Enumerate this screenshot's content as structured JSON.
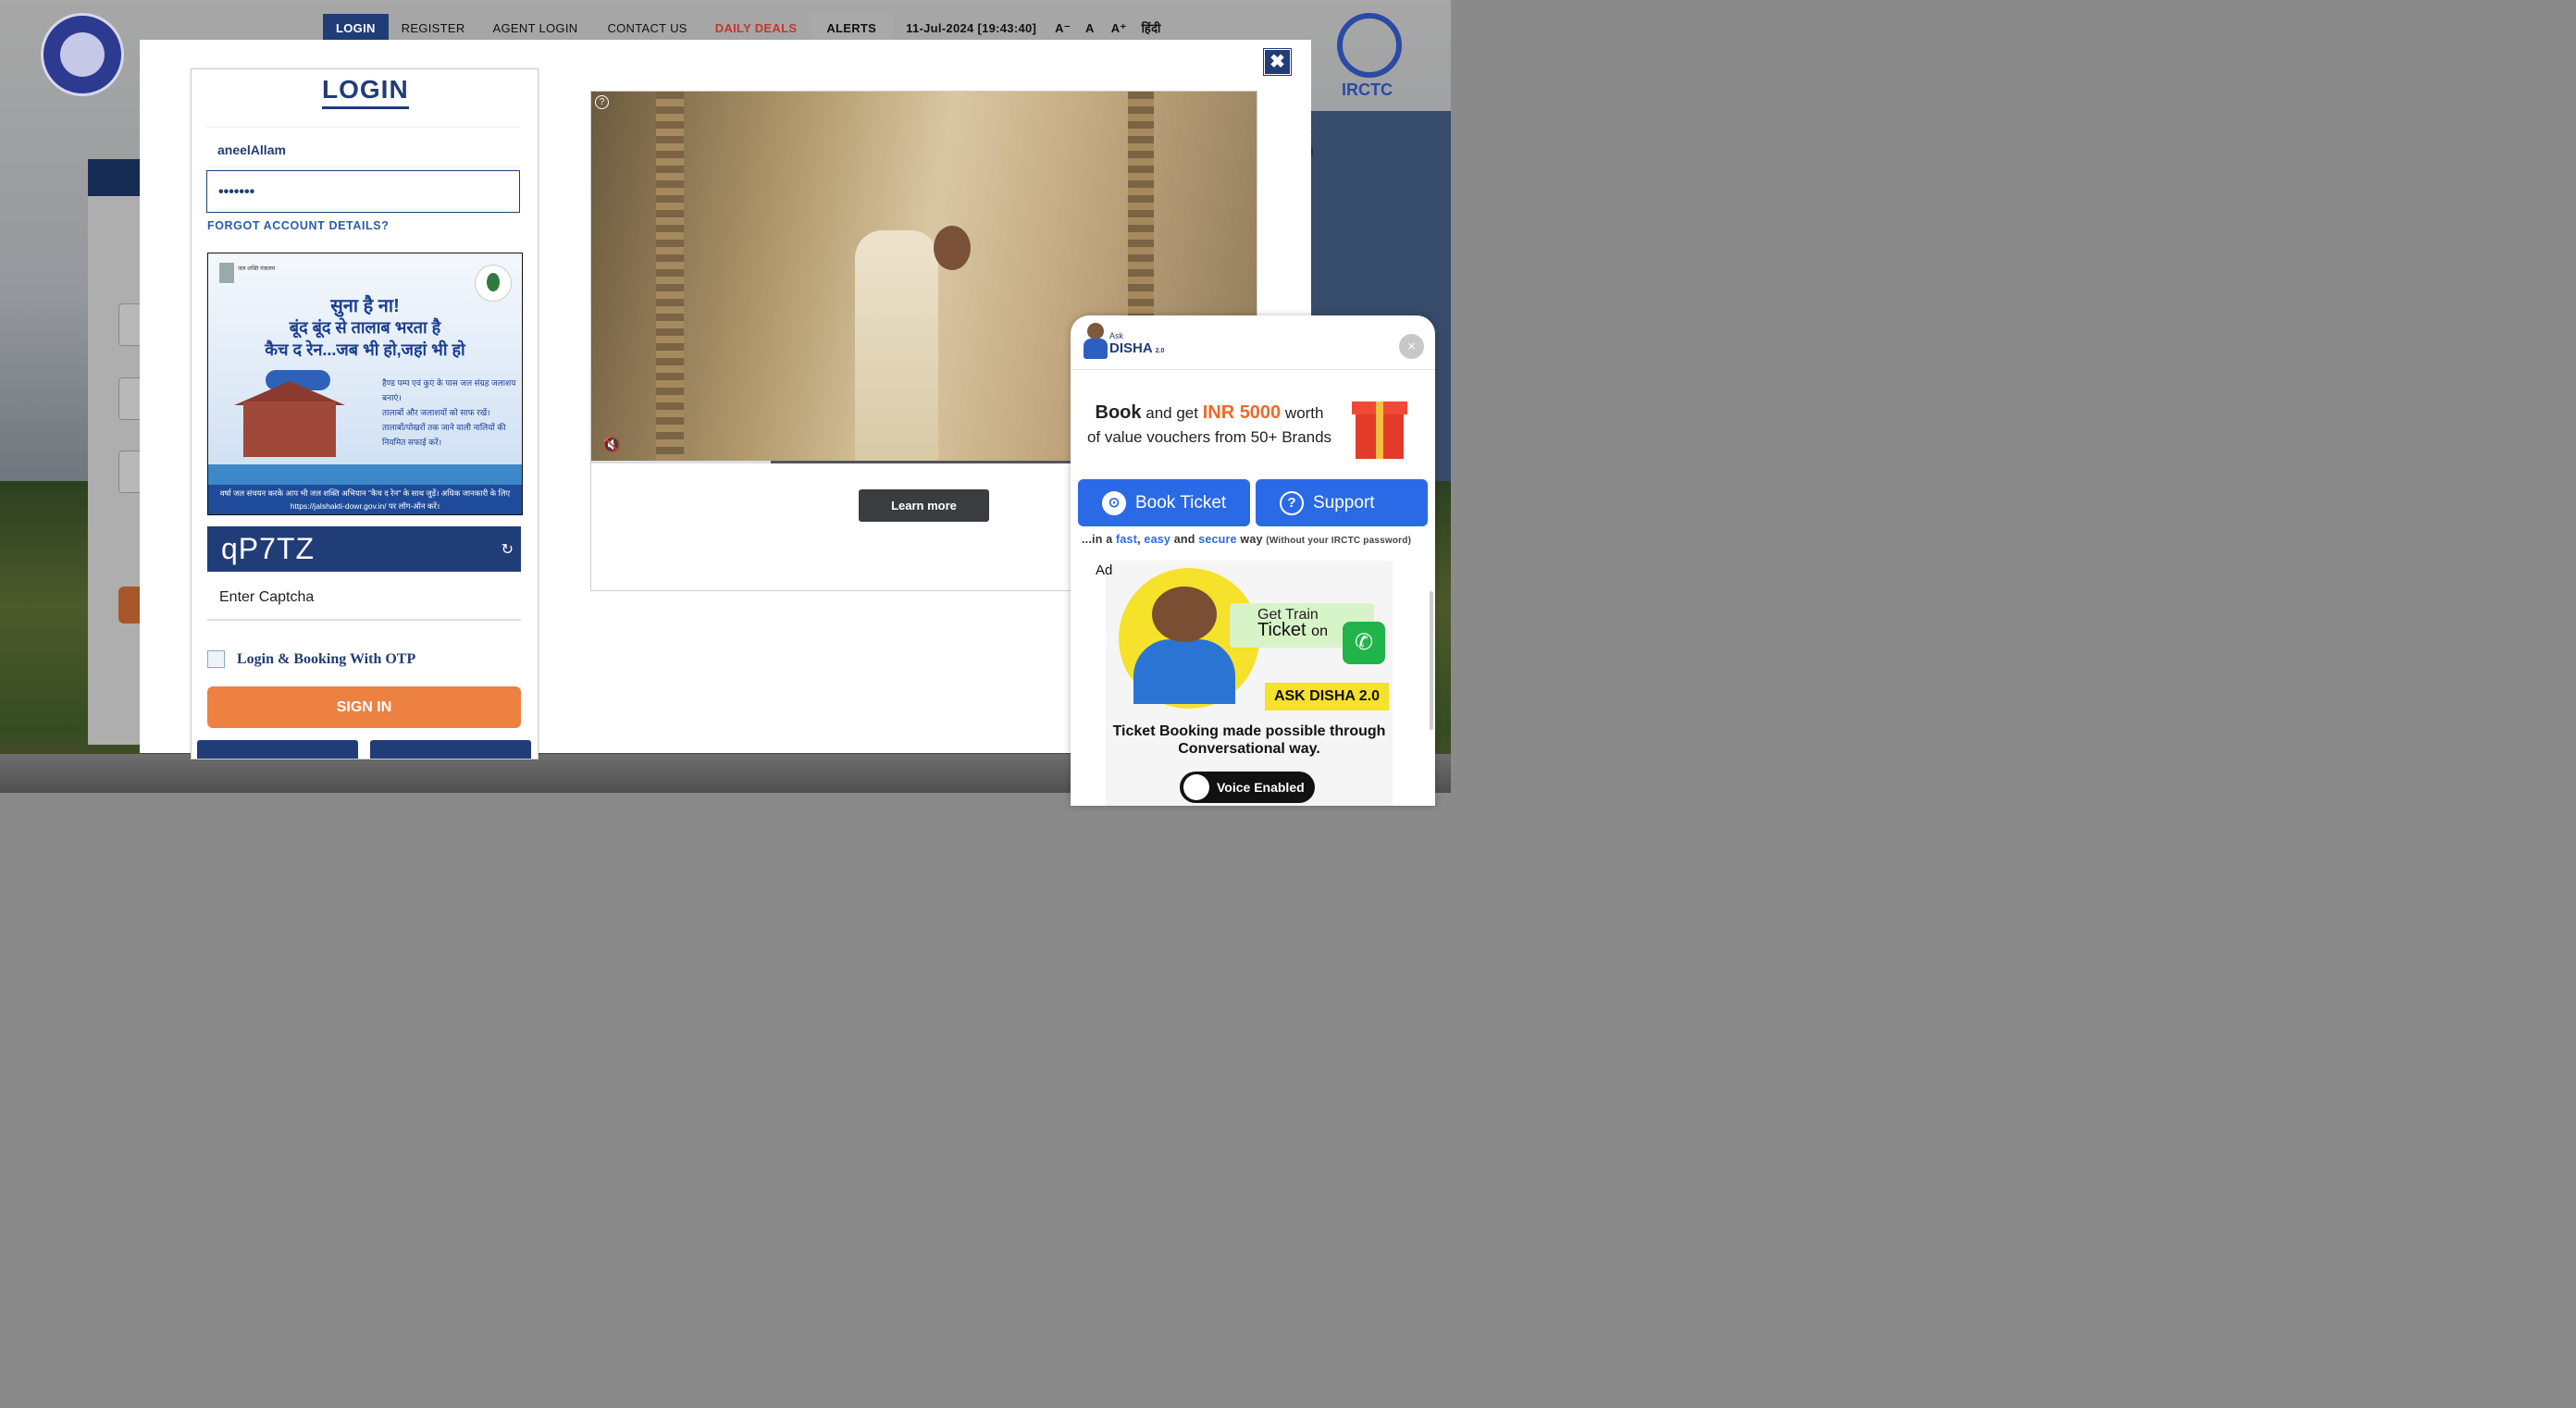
{
  "nav": {
    "items": [
      "LOGIN",
      "REGISTER",
      "AGENT LOGIN",
      "CONTACT US",
      "DAILY DEALS",
      "ALERTS"
    ],
    "datetime": "11-Jul-2024 [19:43:40]",
    "font_small": "A⁻",
    "font_normal": "A",
    "font_large": "A⁺",
    "hindi": "हिंदी"
  },
  "logos": {
    "irctc": "IRCTC"
  },
  "modal": {
    "close_icon": "✖",
    "login": {
      "title": "LOGIN",
      "username": "aneelAllam",
      "password_mask": "•••••••",
      "forgot": "FORGOT ACCOUNT DETAILS?",
      "captcha_code": "qP7TZ",
      "captcha_refresh_icon": "↻",
      "captcha_placeholder": "Enter Captcha",
      "otp_label": "Login & Booking With OTP",
      "signin": "SIGN IN"
    },
    "jal_ad": {
      "ministry": "जल शक्ति मंत्रालय",
      "line1": "सुना है ना!",
      "line2": "बूंद बूंद से तालाब भरता है",
      "line3": "कैच द रेन...जब भी हो,जहां भी हो",
      "bullets": [
        "हैण्ड पम्प एवं कुएं के पास जल संग्रह जलाशय बनाएं।",
        "तालाबों और जलाशयों को साफ रखें।",
        "तालाबों/पोखरों तक जाने वाली नालियों की नियमित सफाई करें।"
      ],
      "footer": "वर्षा जल संचयन करके आप भी जल शक्ति अभियान \"कैच द रेन\" के साथ जुड़ें। अधिक जानकारी के लिए https://jalshakti-dowr.gov.in/ पर लॉग-ऑन करें।"
    },
    "video_ad": {
      "help_icon": "?",
      "mute_icon": "🔇",
      "progress": 0.27,
      "learn_more": "Learn more"
    }
  },
  "disha": {
    "ask": "Ask",
    "name": "DISHA",
    "version": "2.0",
    "close_icon": "×",
    "promo_book": "Book",
    "promo_and": " and get ",
    "promo_inr": "INR 5000",
    "promo_worth": " worth",
    "promo_line2": "of value vouchers from 50+ Brands",
    "book_ticket": "Book Ticket",
    "support": "Support",
    "tag_pre": "...in a ",
    "tag_fast": "fast",
    "tag_easy": "easy",
    "tag_and": " and ",
    "tag_secure": "secure",
    "tag_way": " way ",
    "tag_small": "(Without your IRCTC password)",
    "ad_label": "Ad",
    "ad_get": "Get Train",
    "ad_ticket": "Ticket",
    "ad_on": "on",
    "ad_badge": "ASK DISHA 2.0",
    "ad_body": "Ticket Booking made possible through Conversational way.",
    "ad_voice": "Voice Enabled"
  },
  "colors": {
    "primary": "#213d77",
    "accent": "#ec8141",
    "disha_blue": "#2b6ae6"
  }
}
